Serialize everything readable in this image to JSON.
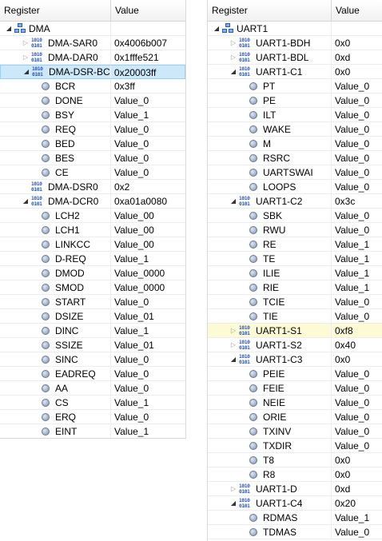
{
  "columns": {
    "register": "Register",
    "value": "Value"
  },
  "left_rows": [
    {
      "name": "DMA",
      "value": "",
      "level": 0,
      "tw": "open",
      "icon": "peripheral"
    },
    {
      "name": "DMA-SAR0",
      "value": "0x4006b007",
      "level": 1,
      "tw": "closed",
      "icon": "register"
    },
    {
      "name": "DMA-DAR0",
      "value": "0x1fffe521",
      "level": 1,
      "tw": "closed",
      "icon": "register"
    },
    {
      "name": "DMA-DSR-BC",
      "value": "0x20003ff",
      "level": 1,
      "tw": "open",
      "icon": "register",
      "state": "selected"
    },
    {
      "name": "BCR",
      "value": "0x3ff",
      "level": 2,
      "icon": "field"
    },
    {
      "name": "DONE",
      "value": "Value_0",
      "level": 2,
      "icon": "field"
    },
    {
      "name": "BSY",
      "value": "Value_1",
      "level": 2,
      "icon": "field"
    },
    {
      "name": "REQ",
      "value": "Value_0",
      "level": 2,
      "icon": "field"
    },
    {
      "name": "BED",
      "value": "Value_0",
      "level": 2,
      "icon": "field"
    },
    {
      "name": "BES",
      "value": "Value_0",
      "level": 2,
      "icon": "field"
    },
    {
      "name": "CE",
      "value": "Value_0",
      "level": 2,
      "icon": "field"
    },
    {
      "name": "DMA-DSR0",
      "value": "0x2",
      "level": 1,
      "tw": "none",
      "icon": "register"
    },
    {
      "name": "DMA-DCR0",
      "value": "0xa01a0080",
      "level": 1,
      "tw": "open",
      "icon": "register"
    },
    {
      "name": "LCH2",
      "value": "Value_00",
      "level": 2,
      "icon": "field"
    },
    {
      "name": "LCH1",
      "value": "Value_00",
      "level": 2,
      "icon": "field"
    },
    {
      "name": "LINKCC",
      "value": "Value_00",
      "level": 2,
      "icon": "field"
    },
    {
      "name": "D-REQ",
      "value": "Value_1",
      "level": 2,
      "icon": "field"
    },
    {
      "name": "DMOD",
      "value": "Value_0000",
      "level": 2,
      "icon": "field"
    },
    {
      "name": "SMOD",
      "value": "Value_0000",
      "level": 2,
      "icon": "field"
    },
    {
      "name": "START",
      "value": "Value_0",
      "level": 2,
      "icon": "field"
    },
    {
      "name": "DSIZE",
      "value": "Value_01",
      "level": 2,
      "icon": "field"
    },
    {
      "name": "DINC",
      "value": "Value_1",
      "level": 2,
      "icon": "field"
    },
    {
      "name": "SSIZE",
      "value": "Value_01",
      "level": 2,
      "icon": "field"
    },
    {
      "name": "SINC",
      "value": "Value_0",
      "level": 2,
      "icon": "field"
    },
    {
      "name": "EADREQ",
      "value": "Value_0",
      "level": 2,
      "icon": "field"
    },
    {
      "name": "AA",
      "value": "Value_0",
      "level": 2,
      "icon": "field"
    },
    {
      "name": "CS",
      "value": "Value_1",
      "level": 2,
      "icon": "field"
    },
    {
      "name": "ERQ",
      "value": "Value_0",
      "level": 2,
      "icon": "field"
    },
    {
      "name": "EINT",
      "value": "Value_1",
      "level": 2,
      "icon": "field"
    }
  ],
  "right_rows": [
    {
      "name": "UART1",
      "value": "",
      "level": 0,
      "tw": "open",
      "icon": "peripheral"
    },
    {
      "name": "UART1-BDH",
      "value": "0x0",
      "level": 1,
      "tw": "closed",
      "icon": "register"
    },
    {
      "name": "UART1-BDL",
      "value": "0xd",
      "level": 1,
      "tw": "closed",
      "icon": "register"
    },
    {
      "name": "UART1-C1",
      "value": "0x0",
      "level": 1,
      "tw": "open",
      "icon": "register"
    },
    {
      "name": "PT",
      "value": "Value_0",
      "level": 2,
      "icon": "field"
    },
    {
      "name": "PE",
      "value": "Value_0",
      "level": 2,
      "icon": "field"
    },
    {
      "name": "ILT",
      "value": "Value_0",
      "level": 2,
      "icon": "field"
    },
    {
      "name": "WAKE",
      "value": "Value_0",
      "level": 2,
      "icon": "field"
    },
    {
      "name": "M",
      "value": "Value_0",
      "level": 2,
      "icon": "field"
    },
    {
      "name": "RSRC",
      "value": "Value_0",
      "level": 2,
      "icon": "field"
    },
    {
      "name": "UARTSWAI",
      "value": "Value_0",
      "level": 2,
      "icon": "field"
    },
    {
      "name": "LOOPS",
      "value": "Value_0",
      "level": 2,
      "icon": "field"
    },
    {
      "name": "UART1-C2",
      "value": "0x3c",
      "level": 1,
      "tw": "open",
      "icon": "register"
    },
    {
      "name": "SBK",
      "value": "Value_0",
      "level": 2,
      "icon": "field"
    },
    {
      "name": "RWU",
      "value": "Value_0",
      "level": 2,
      "icon": "field"
    },
    {
      "name": "RE",
      "value": "Value_1",
      "level": 2,
      "icon": "field"
    },
    {
      "name": "TE",
      "value": "Value_1",
      "level": 2,
      "icon": "field"
    },
    {
      "name": "ILIE",
      "value": "Value_1",
      "level": 2,
      "icon": "field"
    },
    {
      "name": "RIE",
      "value": "Value_1",
      "level": 2,
      "icon": "field"
    },
    {
      "name": "TCIE",
      "value": "Value_0",
      "level": 2,
      "icon": "field"
    },
    {
      "name": "TIE",
      "value": "Value_0",
      "level": 2,
      "icon": "field"
    },
    {
      "name": "UART1-S1",
      "value": "0xf8",
      "level": 1,
      "tw": "closed",
      "icon": "register",
      "state": "highlighted"
    },
    {
      "name": "UART1-S2",
      "value": "0x40",
      "level": 1,
      "tw": "closed",
      "icon": "register"
    },
    {
      "name": "UART1-C3",
      "value": "0x0",
      "level": 1,
      "tw": "open",
      "icon": "register"
    },
    {
      "name": "PEIE",
      "value": "Value_0",
      "level": 2,
      "icon": "field"
    },
    {
      "name": "FEIE",
      "value": "Value_0",
      "level": 2,
      "icon": "field"
    },
    {
      "name": "NEIE",
      "value": "Value_0",
      "level": 2,
      "icon": "field"
    },
    {
      "name": "ORIE",
      "value": "Value_0",
      "level": 2,
      "icon": "field"
    },
    {
      "name": "TXINV",
      "value": "Value_0",
      "level": 2,
      "icon": "field"
    },
    {
      "name": "TXDIR",
      "value": "Value_0",
      "level": 2,
      "icon": "field"
    },
    {
      "name": "T8",
      "value": "0x0",
      "level": 2,
      "icon": "field"
    },
    {
      "name": "R8",
      "value": "0x0",
      "level": 2,
      "icon": "field"
    },
    {
      "name": "UART1-D",
      "value": "0xd",
      "level": 1,
      "tw": "closed",
      "icon": "register"
    },
    {
      "name": "UART1-C4",
      "value": "0x20",
      "level": 1,
      "tw": "open",
      "icon": "register"
    },
    {
      "name": "RDMAS",
      "value": "Value_1",
      "level": 2,
      "icon": "field"
    },
    {
      "name": "TDMAS",
      "value": "Value_0",
      "level": 2,
      "icon": "field"
    }
  ]
}
